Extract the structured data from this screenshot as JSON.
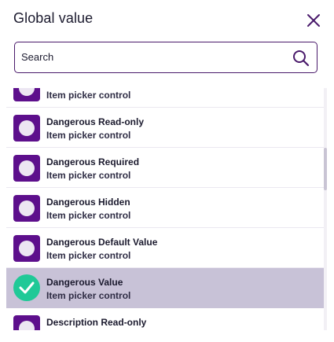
{
  "dialog": {
    "title": "Global value"
  },
  "search": {
    "placeholder": "Search",
    "value": ""
  },
  "items": [
    {
      "title": "",
      "subtitle": "Item picker control",
      "selected": false,
      "icon": "avatar-circle-icon"
    },
    {
      "title": "Dangerous Read-only",
      "subtitle": "Item picker control",
      "selected": false,
      "icon": "avatar-circle-icon"
    },
    {
      "title": "Dangerous Required",
      "subtitle": "Item picker control",
      "selected": false,
      "icon": "avatar-circle-icon"
    },
    {
      "title": "Dangerous Hidden",
      "subtitle": "Item picker control",
      "selected": false,
      "icon": "avatar-circle-icon"
    },
    {
      "title": "Dangerous Default Value",
      "subtitle": "Item picker control",
      "selected": false,
      "icon": "avatar-circle-icon"
    },
    {
      "title": "Dangerous Value",
      "subtitle": "Item picker control",
      "selected": true,
      "icon": "checkmark-icon"
    },
    {
      "title": "Description Read-only",
      "subtitle": "",
      "selected": false,
      "icon": "avatar-circle-icon"
    }
  ],
  "colors": {
    "accent": "#5d0f8c",
    "selected_bg": "#c8c2d7",
    "check": "#20c997"
  }
}
